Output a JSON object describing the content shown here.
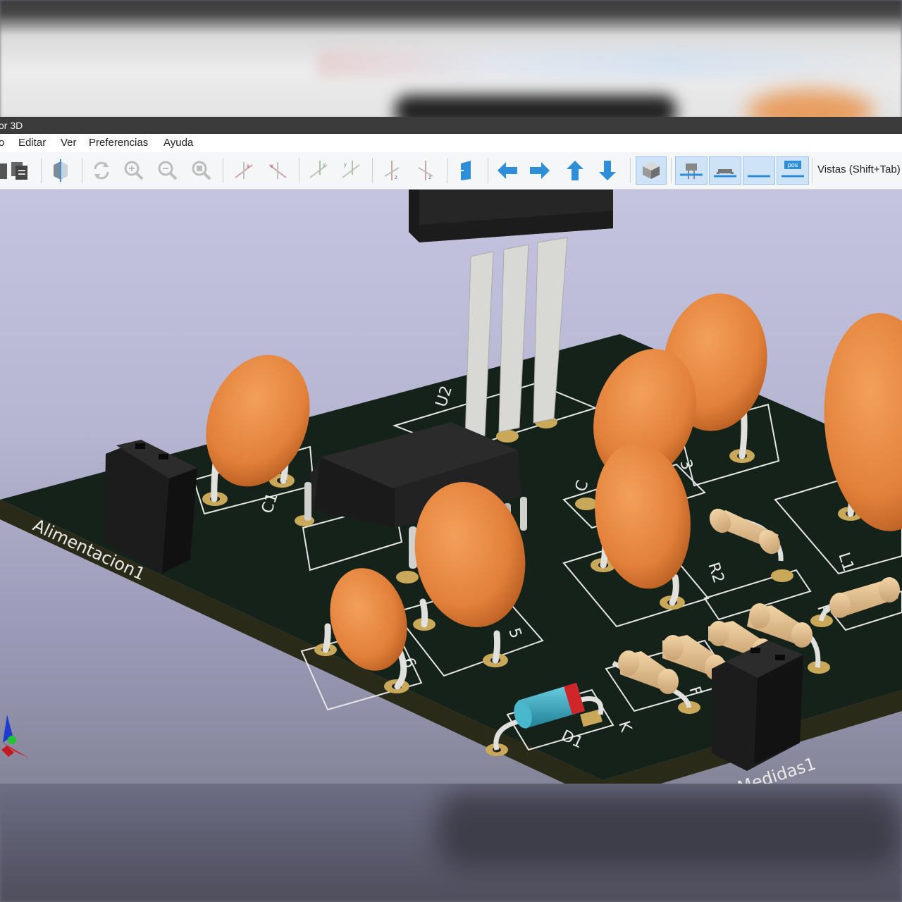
{
  "window": {
    "title": "or 3D"
  },
  "menu": {
    "items": [
      "o",
      "Editar",
      "Ver",
      "Preferencias",
      "Ayuda"
    ]
  },
  "toolbar": {
    "views_label": "Vistas (Shift+Tab)",
    "pos_label": "pos"
  },
  "board": {
    "silkscreen": {
      "u2": "U2",
      "c1": "C1",
      "c3": "3",
      "c_left": "C",
      "c5": "5",
      "c6": "6",
      "r2": "R2",
      "l1": "L1",
      "r_b": "R",
      "r_f": "F",
      "k": "K",
      "d1": "D1",
      "alimentacion": "Alimentacion1",
      "medidas": "Medidas1"
    }
  },
  "colors": {
    "pcb": "#152219",
    "capacitor": "#e2803a",
    "pad": "#c9a85a",
    "silk": "#e9e9e9",
    "viewport_top": "#c4c4e0",
    "diode_body": "#2fa3bd",
    "diode_band": "#d0262a"
  }
}
